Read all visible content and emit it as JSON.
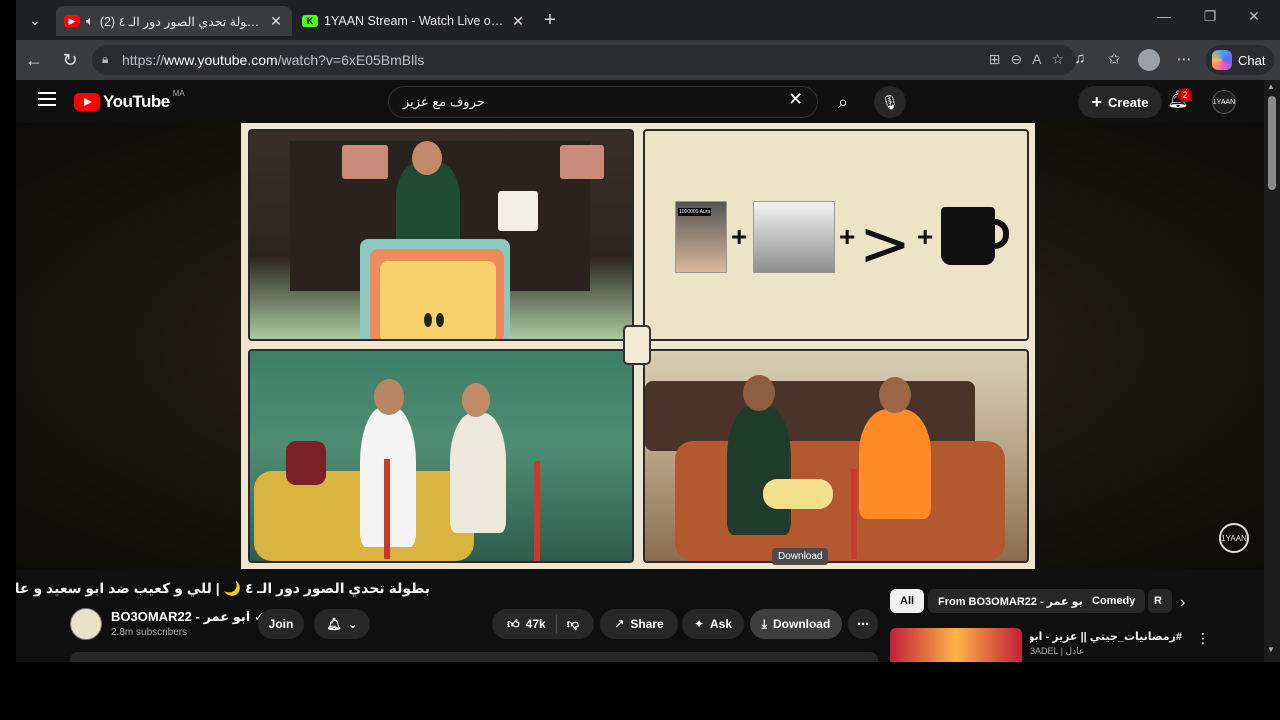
{
  "browser": {
    "tabs": [
      {
        "title": "(2) بطولة تحدي الصور دور الـ ٤ |",
        "active": true,
        "favicon": "youtube-icon"
      },
      {
        "title": "1YAAN Stream - Watch Live on Kick",
        "active": false,
        "favicon": "kick-icon"
      }
    ],
    "url_prefix": "https://",
    "url_host": "www.youtube.com",
    "url_path": "/watch?v=6xE05BmBlls",
    "copilot_label": "Chat"
  },
  "youtube": {
    "logo_text": "YouTube",
    "country_code": "MA",
    "search_query": "حروف مع عزيز",
    "create_label": "Create",
    "notification_count": "2",
    "account_label": "1YAAN"
  },
  "player": {
    "tooltip": "Download",
    "equation_caption": "1000000 Aura"
  },
  "video": {
    "title": "بطولة تحدي الصور دور الـ ٤ 🌙 | للي و كعيب ضد ابو سعيد و عامر",
    "channel_name": "BO3OMAR22 - ابو عمر ✓",
    "subscribers": "2.8m subscribers",
    "join_label": "Join",
    "like_count": "47k",
    "share_label": "Share",
    "ask_label": "Ask",
    "download_label": "Download"
  },
  "chips": [
    "All",
    "From BO3OMAR22 - ابو عمر",
    "Comedy",
    "R"
  ],
  "recommendation": {
    "title": "#رمضانيات_جيتي || عزيز - ابو عبير 🌙",
    "channel": "3ADEL | عادل"
  },
  "colors": {
    "brand_red": "#ff0000",
    "badge_red": "#cc0000",
    "chip_active_bg": "#f1f1f1"
  }
}
